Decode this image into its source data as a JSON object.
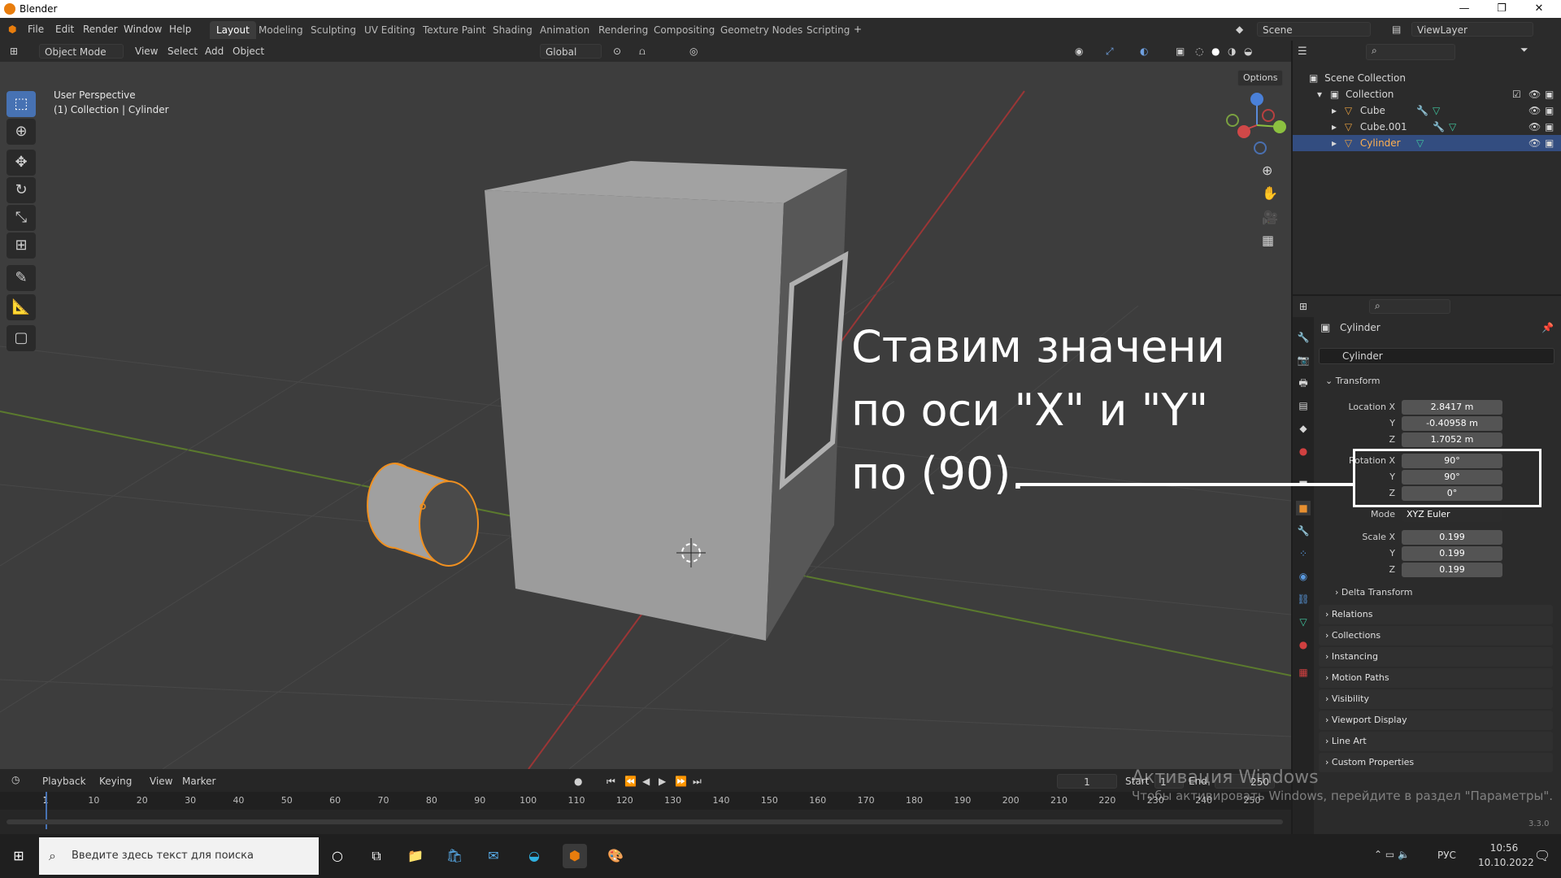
{
  "window": {
    "title": "Blender",
    "minimize": "—",
    "maximize": "❐",
    "close": "✕"
  },
  "menu": {
    "items": [
      "File",
      "Edit",
      "Render",
      "Window",
      "Help"
    ]
  },
  "workspaces": [
    "Layout",
    "Modeling",
    "Sculpting",
    "UV Editing",
    "Texture Paint",
    "Shading",
    "Animation",
    "Rendering",
    "Compositing",
    "Geometry Nodes",
    "Scripting"
  ],
  "scene": {
    "label": "Scene",
    "viewlayer": "ViewLayer"
  },
  "viewport_header": {
    "mode": "Object Mode",
    "view": "View",
    "select": "Select",
    "add": "Add",
    "object": "Object",
    "orientation": "Global",
    "options": "Options"
  },
  "viewport": {
    "perspective": "User Perspective",
    "collection_info": "(1) Collection | Cylinder"
  },
  "outliner": {
    "scene_collection": "Scene Collection",
    "collection": "Collection",
    "objects": [
      "Cube",
      "Cube.001",
      "Cylinder"
    ],
    "selected": "Cylinder"
  },
  "properties": {
    "object_name": "Cylinder",
    "data_name": "Cylinder",
    "transform_label": "Transform",
    "location": {
      "label_x": "Location X",
      "label_y": "Y",
      "label_z": "Z",
      "x": "2.8417 m",
      "y": "-0.40958 m",
      "z": "1.7052 m"
    },
    "rotation": {
      "label_x": "Rotation X",
      "label_y": "Y",
      "label_z": "Z",
      "x": "90°",
      "y": "90°",
      "z": "0°"
    },
    "mode_label": "Mode",
    "mode_value": "XYZ Euler",
    "scale": {
      "label_x": "Scale X",
      "label_y": "Y",
      "label_z": "Z",
      "x": "0.199",
      "y": "0.199",
      "z": "0.199"
    },
    "delta": "Delta Transform",
    "panels": [
      "Relations",
      "Collections",
      "Instancing",
      "Motion Paths",
      "Visibility",
      "Viewport Display",
      "Line Art",
      "Custom Properties"
    ]
  },
  "annotation": {
    "line1": "Ставим значени",
    "line2": "по оси \"X\" и \"Y\"",
    "line3": "по (90)."
  },
  "timeline": {
    "playback": "Playback",
    "keying": "Keying",
    "view": "View",
    "marker": "Marker",
    "current_frame": "1",
    "start_label": "Start",
    "start": "1",
    "end_label": "End",
    "end": "250",
    "ticks": [
      "1",
      "10",
      "20",
      "30",
      "40",
      "50",
      "60",
      "70",
      "80",
      "90",
      "100",
      "110",
      "120",
      "130",
      "140",
      "150",
      "160",
      "170",
      "180",
      "190",
      "200",
      "210",
      "220",
      "230",
      "240",
      "250"
    ]
  },
  "watermark": {
    "line1": "Активация Windows",
    "line2": "Чтобы активировать Windows, перейдите в раздел \"Параметры\"."
  },
  "version": "3.3.0",
  "taskbar": {
    "search_placeholder": "Введите здесь текст для поиска",
    "lang": "РУС",
    "time": "10:56",
    "date": "10.10.2022"
  }
}
